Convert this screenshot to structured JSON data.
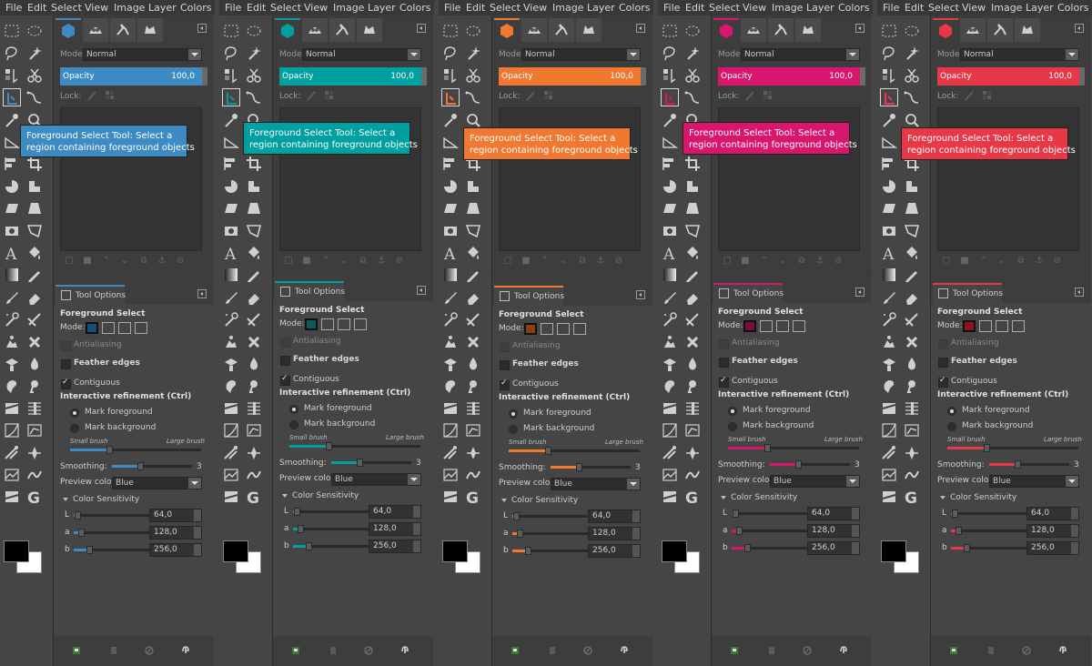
{
  "menu": [
    "File",
    "Edit",
    "Select",
    "View",
    "Image",
    "Layer",
    "Colors"
  ],
  "panels": [
    {
      "accent": "#3d8bc2",
      "accent_dark": "#14507a"
    },
    {
      "accent": "#00a0a0",
      "accent_dark": "#0e5a5a"
    },
    {
      "accent": "#f07830",
      "accent_dark": "#8a3f10"
    },
    {
      "accent": "#d8166e",
      "accent_dark": "#7c0c40"
    },
    {
      "accent": "#e83848",
      "accent_dark": "#8a1520"
    }
  ],
  "icons": {
    "tabs": [
      "layers-icon",
      "channels-icon",
      "paths-icon",
      "undo-history-icon"
    ],
    "tools": [
      "rect-select-icon",
      "ellipse-select-icon",
      "free-select-icon",
      "fuzzy-select-icon",
      "select-by-color-icon",
      "scissors-icon",
      "foreground-select-icon",
      "paths-tool-icon",
      "color-picker-icon",
      "zoom-icon",
      "measure-icon",
      "move-icon",
      "align-icon",
      "crop-icon",
      "unified-transform-icon",
      "rotate-icon",
      "shear-icon",
      "perspective-icon",
      "flip-icon",
      "cage-icon",
      "text-icon",
      "bucket-fill-icon",
      "blend-icon",
      "pencil-icon",
      "paintbrush-icon",
      "eraser-icon",
      "airbrush-icon",
      "ink-icon",
      "clone-icon",
      "heal-icon",
      "perspective-clone-icon",
      "blur-icon",
      "smudge-icon",
      "dodge-burn-icon",
      "warp-icon",
      "levels-icon",
      "curves-icon",
      "hue-saturation-icon",
      "desaturate-icon",
      "gegl-icon",
      "warp-transform-icon",
      "gradient-map-icon",
      "threshold-icon",
      "g-icon"
    ]
  },
  "layers_panel": {
    "mode_label": "Mode:",
    "mode_value": "Normal",
    "opacity_label": "Opacity",
    "opacity_value": "100,0",
    "lock_label": "Lock:"
  },
  "tooltip": {
    "line1": "Foreground Select Tool: Select a",
    "line2": "region containing foreground objects"
  },
  "tool_options": {
    "tab_label": "Tool Options",
    "title": "Foreground Select",
    "mode_label": "Mode:",
    "antialiasing": "Antialiasing",
    "feather": "Feather edges",
    "contiguous": "Contiguous",
    "refinement": "Interactive refinement  (Ctrl)",
    "mark_fg": "Mark foreground",
    "mark_bg": "Mark background",
    "small_brush": "Small brush",
    "large_brush": "Large brush",
    "brush_size_fraction": 0.3,
    "smoothing_label": "Smoothing:",
    "smoothing_value": "3",
    "smoothing_fraction": 0.35,
    "preview_label": "Preview color:",
    "preview_value": "Blue",
    "sensitivity_title": "Color Sensitivity",
    "channels": [
      {
        "label": "L",
        "value": "64,0",
        "fraction": 0.05
      },
      {
        "label": "a",
        "value": "128,0",
        "fraction": 0.1
      },
      {
        "label": "b",
        "value": "256,0",
        "fraction": 0.2
      }
    ]
  }
}
